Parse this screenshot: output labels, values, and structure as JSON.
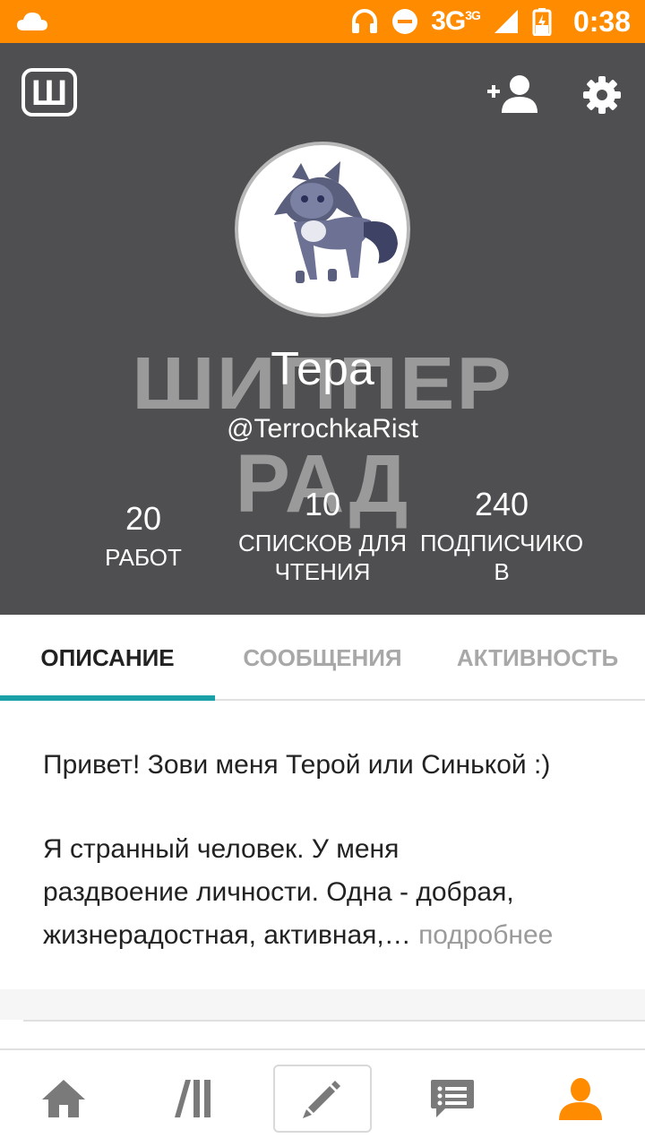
{
  "status_bar": {
    "network": "3G",
    "network_sup": "3G",
    "time": "0:38"
  },
  "profile": {
    "display_name": "Тера",
    "username": "@TerrochkaRist",
    "watermark_line1": "ШИППЕР",
    "watermark_line2": "РАД"
  },
  "stats": [
    {
      "value": "20",
      "label_line1": "РАБОТ",
      "label_line2": ""
    },
    {
      "value": "10",
      "label_line1": "СПИСКОВ ДЛЯ",
      "label_line2": "ЧТЕНИЯ"
    },
    {
      "value": "240",
      "label_line1": "ПОДПИСЧИКО",
      "label_line2": "В"
    }
  ],
  "tabs": [
    {
      "label": "ОПИСАНИЕ",
      "active": true
    },
    {
      "label": "СООБЩЕНИЯ",
      "active": false
    },
    {
      "label": "АКТИВНОСТЬ",
      "active": false
    }
  ],
  "description": {
    "line1": "Привет! Зови меня Терой или Синькой :)",
    "line2": "Я странный человек. У меня",
    "line3": "раздвоение личности. Одна - добрая,",
    "line4": "жизнерадостная, активная,…",
    "more": "подробнее"
  },
  "nav": [
    "home-icon",
    "library-icon",
    "write-icon",
    "messages-icon",
    "profile-icon"
  ],
  "colors": {
    "status_bar": "#ff8c00",
    "header_bg": "#4f4e50",
    "accent": "#1aa1a8",
    "active_nav": "#ff8c00",
    "nav_icon": "#7a7a7a"
  }
}
